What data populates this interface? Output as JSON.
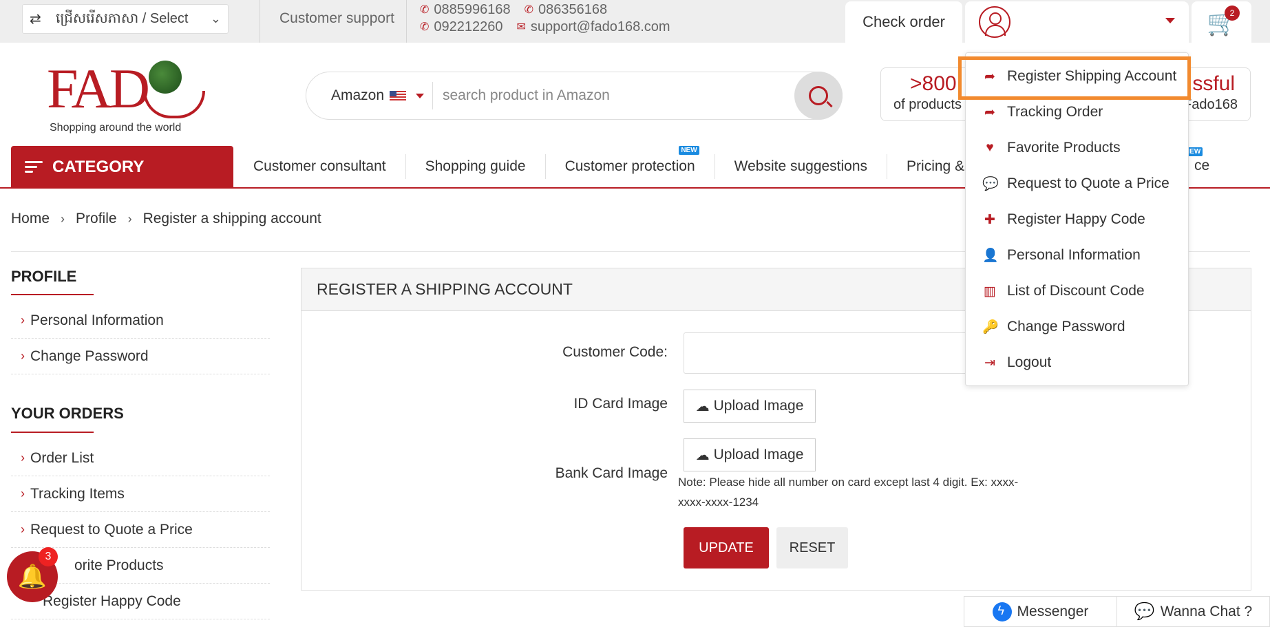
{
  "topbar": {
    "language": "ជ្រើសរើសភាសា / Select",
    "support": "Customer support",
    "phone1": "0885996168",
    "phone2": "086356168",
    "phone3": "092212260",
    "email": "support@fado168.com",
    "check_order": "Check order",
    "cart_count": "2"
  },
  "header": {
    "logo_text": "FAD",
    "logo_tagline": "Shopping around the world",
    "search_source": "Amazon",
    "search_placeholder": "search product in Amazon",
    "stat1_big": ">800",
    "stat1_small": "of products",
    "stat2_big": "ssful",
    "stat2_small": "Fado168"
  },
  "nav": {
    "category": "CATEGORY",
    "items": [
      {
        "label": "Customer consultant",
        "badge": ""
      },
      {
        "label": "Shopping guide",
        "badge": ""
      },
      {
        "label": "Customer protection",
        "badge": "NEW"
      },
      {
        "label": "Website suggestions",
        "badge": ""
      },
      {
        "label": "Pricing &",
        "badge": ""
      }
    ],
    "trailing_text": "ce",
    "trailing_badge": "NEW"
  },
  "breadcrumb": [
    "Home",
    "Profile",
    "Register a shipping account"
  ],
  "sidebar": {
    "profile_title": "PROFILE",
    "profile_items": [
      "Personal Information",
      "Change Password"
    ],
    "orders_title": "YOUR ORDERS",
    "order_items": [
      "Order List",
      "Tracking Items",
      "Request to Quote a Price",
      "orite Products",
      "Register Happy Code"
    ]
  },
  "form": {
    "title": "REGISTER A SHIPPING ACCOUNT",
    "customer_code_label": "Customer Code:",
    "customer_code_value": "",
    "id_card_label": "ID Card Image",
    "bank_card_label": "Bank Card Image",
    "upload_label": "Upload Image",
    "note": "Note: Please hide all number on card except last 4 digit. Ex: xxxx-xxxx-xxxx-1234",
    "update": "UPDATE",
    "reset": "RESET"
  },
  "account_menu": [
    {
      "label": "Register Shipping Account",
      "icon": "share-arrow-icon",
      "glyph": "➦"
    },
    {
      "label": "Tracking Order",
      "icon": "share-arrow-icon",
      "glyph": "➦"
    },
    {
      "label": "Favorite Products",
      "icon": "heart-icon",
      "glyph": "♥"
    },
    {
      "label": "Request to Quote a Price",
      "icon": "speech-bubble-icon",
      "glyph": "💬"
    },
    {
      "label": "Register Happy Code",
      "icon": "plus-icon",
      "glyph": "✚"
    },
    {
      "label": "Personal Information",
      "icon": "user-icon",
      "glyph": "👤"
    },
    {
      "label": "List of Discount Code",
      "icon": "barcode-icon",
      "glyph": "▥"
    },
    {
      "label": "Change Password",
      "icon": "key-icon",
      "glyph": "🔑"
    },
    {
      "label": "Logout",
      "icon": "logout-icon",
      "glyph": "⇥"
    }
  ],
  "floating": {
    "notification_count": "3",
    "messenger": "Messenger",
    "wanna_chat": "Wanna Chat ?"
  },
  "colors": {
    "brand_red": "#b81c23",
    "highlight_orange": "#f28a2e",
    "badge_blue": "#1a8be0"
  }
}
